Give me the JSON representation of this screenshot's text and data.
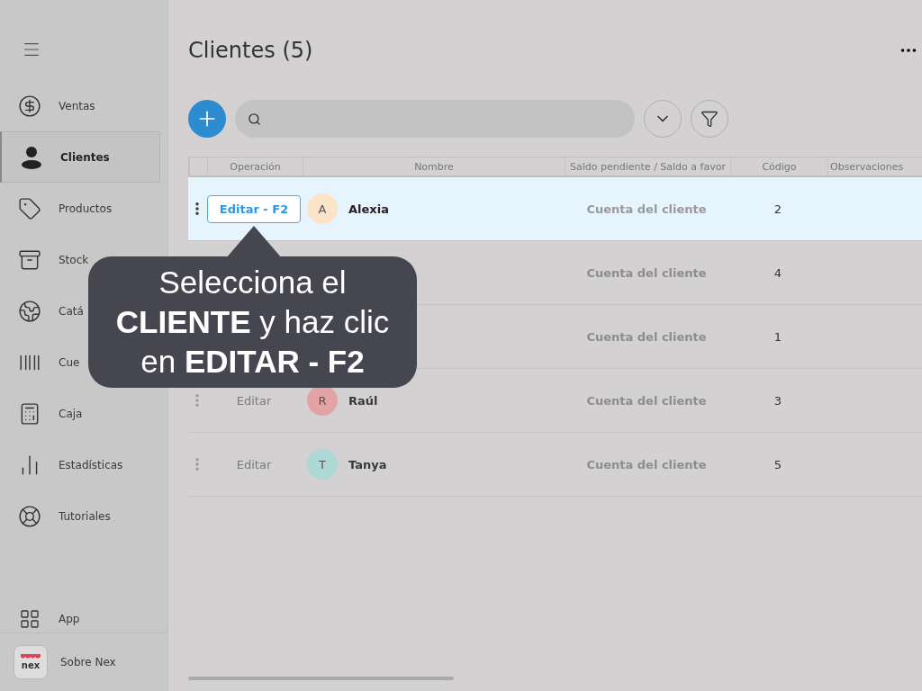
{
  "sidebar": {
    "items": [
      {
        "label": "Ventas",
        "selected": false
      },
      {
        "label": "Clientes",
        "selected": true
      },
      {
        "label": "Productos",
        "selected": false
      },
      {
        "label": "Stock",
        "selected": false
      },
      {
        "label": "Catá",
        "selected": false
      },
      {
        "label": "Cue",
        "selected": false
      },
      {
        "label": "Caja",
        "selected": false
      },
      {
        "label": "Estadísticas",
        "selected": false
      },
      {
        "label": "Tutoriales",
        "selected": false
      }
    ],
    "footer": [
      {
        "label": "App",
        "kind": "link"
      },
      {
        "label": "Sobre Nex",
        "kind": "logo",
        "logo_text": "nex"
      }
    ]
  },
  "title": "Clientes (5)",
  "table": {
    "columns": [
      "Operación",
      "Nombre",
      "Saldo pendiente / Saldo a favor",
      "Código",
      "Observaciones"
    ],
    "rows": [
      {
        "selected": true,
        "operation": "Editar - F2",
        "avatar": "A",
        "color": "#fde3c8",
        "name": "Alexia",
        "balance": "Cuenta del cliente",
        "code": "2"
      },
      {
        "selected": false,
        "balance": "Cuenta del cliente",
        "code": "4"
      },
      {
        "selected": false,
        "balance": "Cuenta del cliente",
        "code": "1"
      },
      {
        "selected": false,
        "operation": "Editar",
        "avatar": "R",
        "color": "#e2a3a5",
        "name": "Raúl",
        "balance": "Cuenta del cliente",
        "code": "3"
      },
      {
        "selected": false,
        "operation": "Editar",
        "avatar": "T",
        "color": "#acd8d6",
        "name": "Tanya",
        "balance": "Cuenta del cliente",
        "code": "5"
      }
    ]
  },
  "tooltip": "Selecciona el **CLIENTE** y haz clic en **EDITAR - F2**"
}
